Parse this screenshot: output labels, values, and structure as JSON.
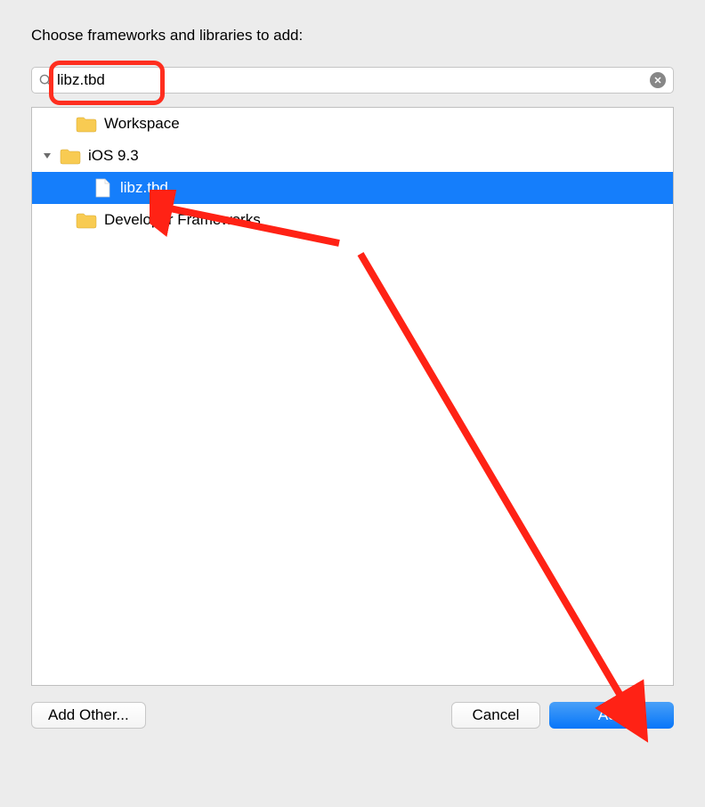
{
  "dialog": {
    "title": "Choose frameworks and libraries to add:"
  },
  "search": {
    "value": "libz.tbd"
  },
  "tree": {
    "items": [
      {
        "label": "Workspace",
        "icon": "folder",
        "indent": 1,
        "selected": false,
        "expandable": false
      },
      {
        "label": "iOS 9.3",
        "icon": "folder",
        "indent": 0,
        "selected": false,
        "expandable": true,
        "expanded": true
      },
      {
        "label": "libz.tbd",
        "icon": "file",
        "indent": 2,
        "selected": true,
        "expandable": false
      },
      {
        "label": "Developer Frameworks",
        "icon": "folder",
        "indent": 1,
        "selected": false,
        "expandable": false
      }
    ]
  },
  "buttons": {
    "addOther": "Add Other...",
    "cancel": "Cancel",
    "add": "Add"
  }
}
